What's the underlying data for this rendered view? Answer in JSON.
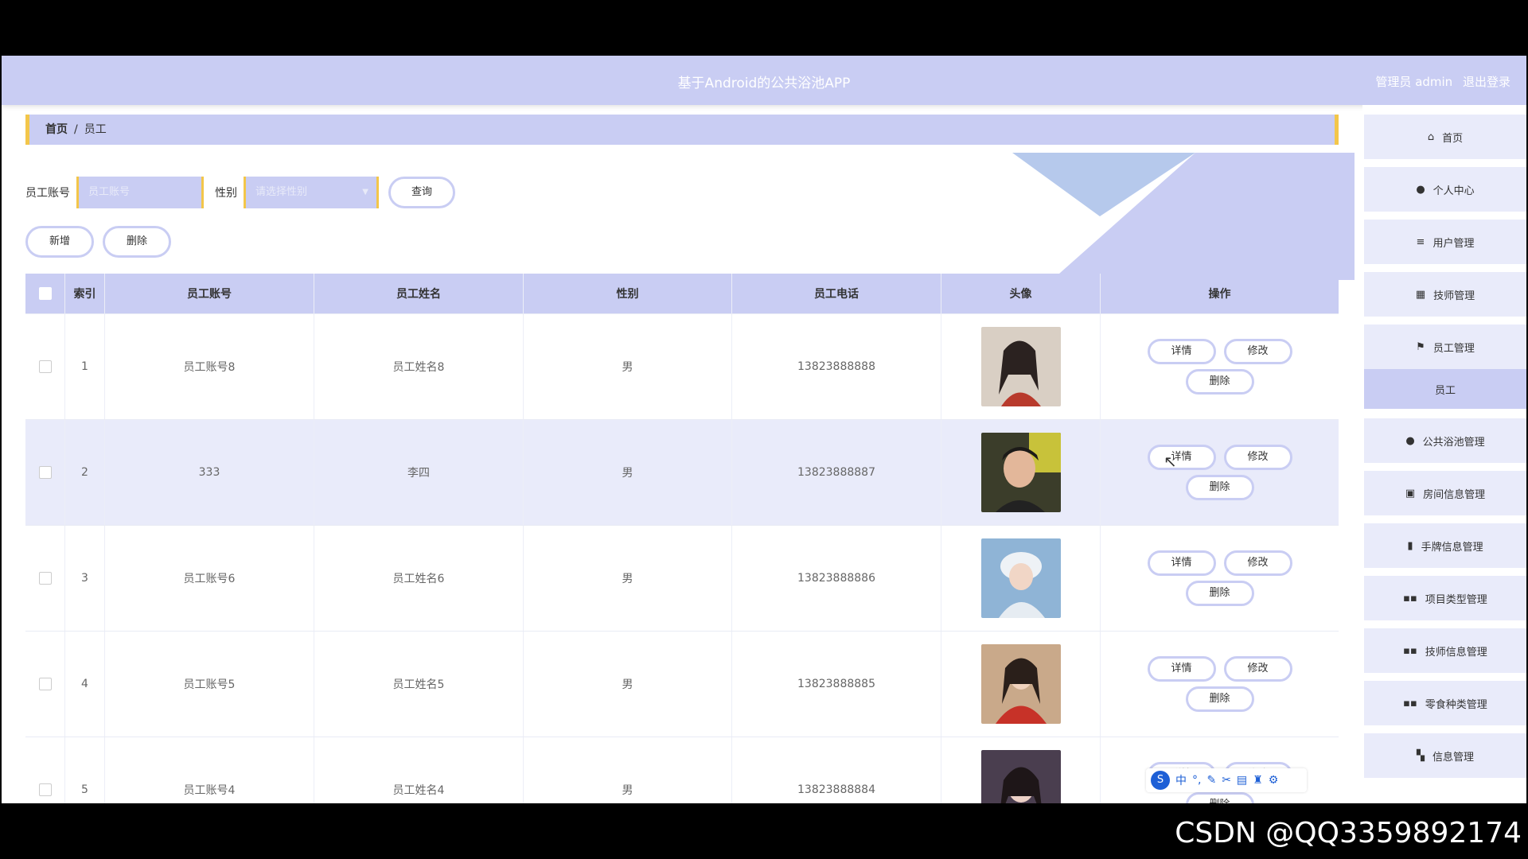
{
  "header": {
    "app_title": "基于Android的公共浴池APP",
    "admin_label": "管理员 admin",
    "logout_label": "退出登录"
  },
  "breadcrumb": {
    "home": "首页",
    "separator": "/",
    "current": "员工"
  },
  "search": {
    "account_label": "员工账号",
    "account_placeholder": "员工账号",
    "gender_label": "性别",
    "gender_placeholder": "请选择性别",
    "query_label": "查询"
  },
  "actions": {
    "add_label": "新增",
    "delete_label": "删除"
  },
  "table": {
    "headers": [
      "索引",
      "员工账号",
      "员工姓名",
      "性别",
      "员工电话",
      "头像",
      "操作"
    ],
    "op_detail": "详情",
    "op_edit": "修改",
    "op_delete": "删除",
    "rows": [
      {
        "index": "1",
        "account": "员工账号8",
        "name": "员工姓名8",
        "gender": "男",
        "phone": "13823888888"
      },
      {
        "index": "2",
        "account": "333",
        "name": "李四",
        "gender": "男",
        "phone": "13823888887"
      },
      {
        "index": "3",
        "account": "员工账号6",
        "name": "员工姓名6",
        "gender": "男",
        "phone": "13823888886"
      },
      {
        "index": "4",
        "account": "员工账号5",
        "name": "员工姓名5",
        "gender": "男",
        "phone": "13823888885"
      },
      {
        "index": "5",
        "account": "员工账号4",
        "name": "员工姓名4",
        "gender": "男",
        "phone": "13823888884"
      }
    ]
  },
  "sidebar": {
    "items": [
      {
        "label": "首页",
        "icon": "home-icon"
      },
      {
        "label": "个人中心",
        "icon": "user-icon"
      },
      {
        "label": "用户管理",
        "icon": "list-icon"
      },
      {
        "label": "技师管理",
        "icon": "grid-icon"
      },
      {
        "label": "员工管理",
        "icon": "flag-icon"
      },
      {
        "label": "员工",
        "icon": ""
      },
      {
        "label": "公共浴池管理",
        "icon": "user-icon"
      },
      {
        "label": "房间信息管理",
        "icon": "clipboard-icon"
      },
      {
        "label": "手牌信息管理",
        "icon": "book-icon"
      },
      {
        "label": "项目类型管理",
        "icon": "apps-icon"
      },
      {
        "label": "技师信息管理",
        "icon": "apps-icon"
      },
      {
        "label": "零食种类管理",
        "icon": "apps-icon"
      },
      {
        "label": "信息管理",
        "icon": "bookmark-icon"
      }
    ]
  },
  "overlay": {
    "ime_logo": "S",
    "ime_mode": "中",
    "watermark": "CSDN @QQ3359892174"
  },
  "colors": {
    "accent": "#c9cdf3",
    "border_yellow": "#f3c64a",
    "row_highlight": "#e9ebfa"
  }
}
